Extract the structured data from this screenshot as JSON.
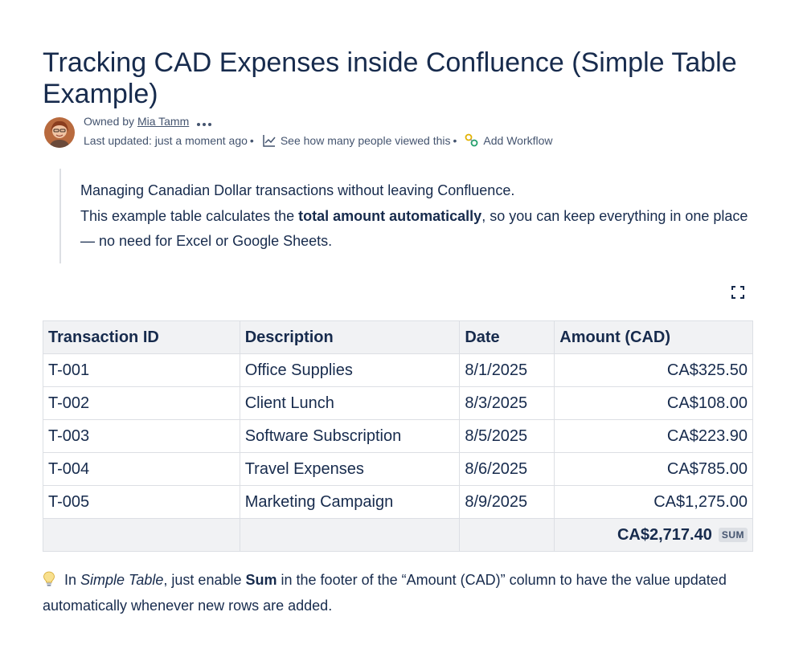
{
  "page": {
    "title": "Tracking CAD Expenses inside Confluence (Simple Table Example)"
  },
  "byline": {
    "owned_by_label": "Owned by",
    "owner_name": "Mia Tamm",
    "last_updated": "Last updated: just a moment ago",
    "separator": "•",
    "views_link": "See how many people viewed this",
    "workflow_label": "Add Workflow",
    "icons": [
      "avatar",
      "more-icon",
      "analytics-icon",
      "workflow-icon"
    ]
  },
  "quote": {
    "line1": "Managing Canadian Dollar transactions without leaving Confluence.",
    "line2_prefix": "This example table calculates the ",
    "line2_bold": "total amount automatically",
    "line2_suffix": ", so you can keep everything in one place — no need for Excel or Google Sheets."
  },
  "table": {
    "headers": [
      "Transaction ID",
      "Description",
      "Date",
      "Amount (CAD)"
    ],
    "rows": [
      {
        "id": "T-001",
        "description": "Office Supplies",
        "date": "8/1/2025",
        "amount": "CA$325.50"
      },
      {
        "id": "T-002",
        "description": "Client Lunch",
        "date": "8/3/2025",
        "amount": "CA$108.00"
      },
      {
        "id": "T-003",
        "description": "Software Subscription",
        "date": "8/5/2025",
        "amount": "CA$223.90"
      },
      {
        "id": "T-004",
        "description": "Travel Expenses",
        "date": "8/6/2025",
        "amount": "CA$785.00"
      },
      {
        "id": "T-005",
        "description": "Marketing Campaign",
        "date": "8/9/2025",
        "amount": "CA$1,275.00"
      }
    ],
    "footer": {
      "total": "CA$2,717.40",
      "badge": "SUM"
    }
  },
  "tip": {
    "prefix": " In ",
    "italic": "Simple Table",
    "middle": ", just enable ",
    "bold": "Sum",
    "suffix": " in the footer of the “Amount (CAD)” column to have the value updated automatically whenever new rows are added."
  },
  "colors": {
    "text": "#172b4d",
    "subtle_text": "#44546f",
    "border": "#dcdfe4",
    "header_bg": "#f1f2f4"
  }
}
